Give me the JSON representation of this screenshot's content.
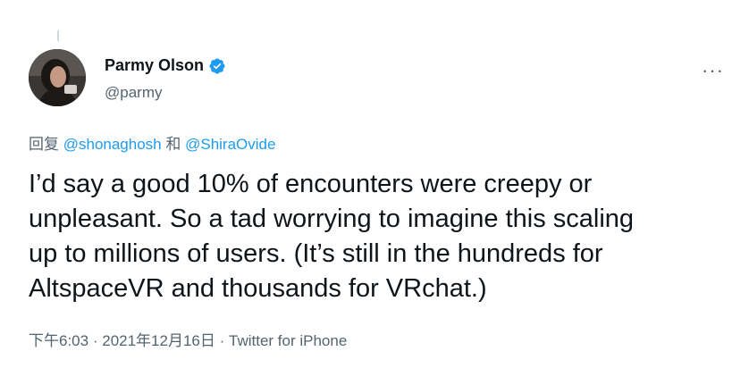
{
  "author": {
    "display_name": "Parmy Olson",
    "handle": "@parmy",
    "verified_icon": "verified-badge-icon",
    "verified_color": "#1d9bf0"
  },
  "more_icon": "···",
  "reply_to": {
    "prefix": "回复",
    "mention_1": "@shonaghosh",
    "joiner": "和",
    "mention_2": "@ShiraOvide"
  },
  "tweet": {
    "lines": [
      "I’d say a good 10% of encounters were creepy or",
      "unpleasant. So a tad worrying to imagine this scaling",
      "up to millions of users. (It’s still in the hundreds for",
      "AltspaceVR and thousands for VRchat.)"
    ]
  },
  "meta": {
    "time": "下午6:03",
    "sep1": "·",
    "date": "2021年12月16日",
    "sep2": "·",
    "source": "Twitter for iPhone"
  },
  "colors": {
    "text": "#0f1419",
    "secondary": "#536471",
    "link": "#1d9bf0"
  }
}
